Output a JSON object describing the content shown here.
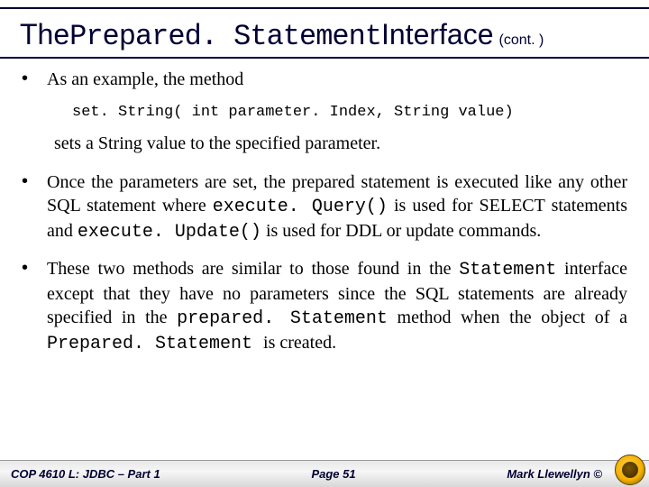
{
  "title": {
    "prefix": "The ",
    "mono": "Prepared. Statement",
    "suffix": " Interface",
    "cont": "(cont. )"
  },
  "bullets": {
    "b1_lead": "As an example, the method",
    "code": "set. String( int parameter. Index, String value)",
    "after_code": "sets a String value to the specified parameter.",
    "b2_p1": "Once the parameters are set, the prepared statement is executed like any other SQL statement where ",
    "b2_m1": "execute. Query()",
    "b2_p2": " is used for SELECT statements and ",
    "b2_m2": "execute. Update()",
    "b2_p3": " is used for DDL or update commands.",
    "b3_p1": "These two methods are similar to those found in the ",
    "b3_m1": "Statement",
    "b3_p2": " interface except that they have no parameters since the SQL statements are already specified in the ",
    "b3_m2": "prepared. Statement",
    "b3_p3": " method when the object of a ",
    "b3_m3": "Prepared. Statement ",
    "b3_p4": "is created."
  },
  "footer": {
    "course": "COP 4610 L: JDBC – Part 1",
    "page": "Page 51",
    "author": "Mark Llewellyn ©"
  }
}
